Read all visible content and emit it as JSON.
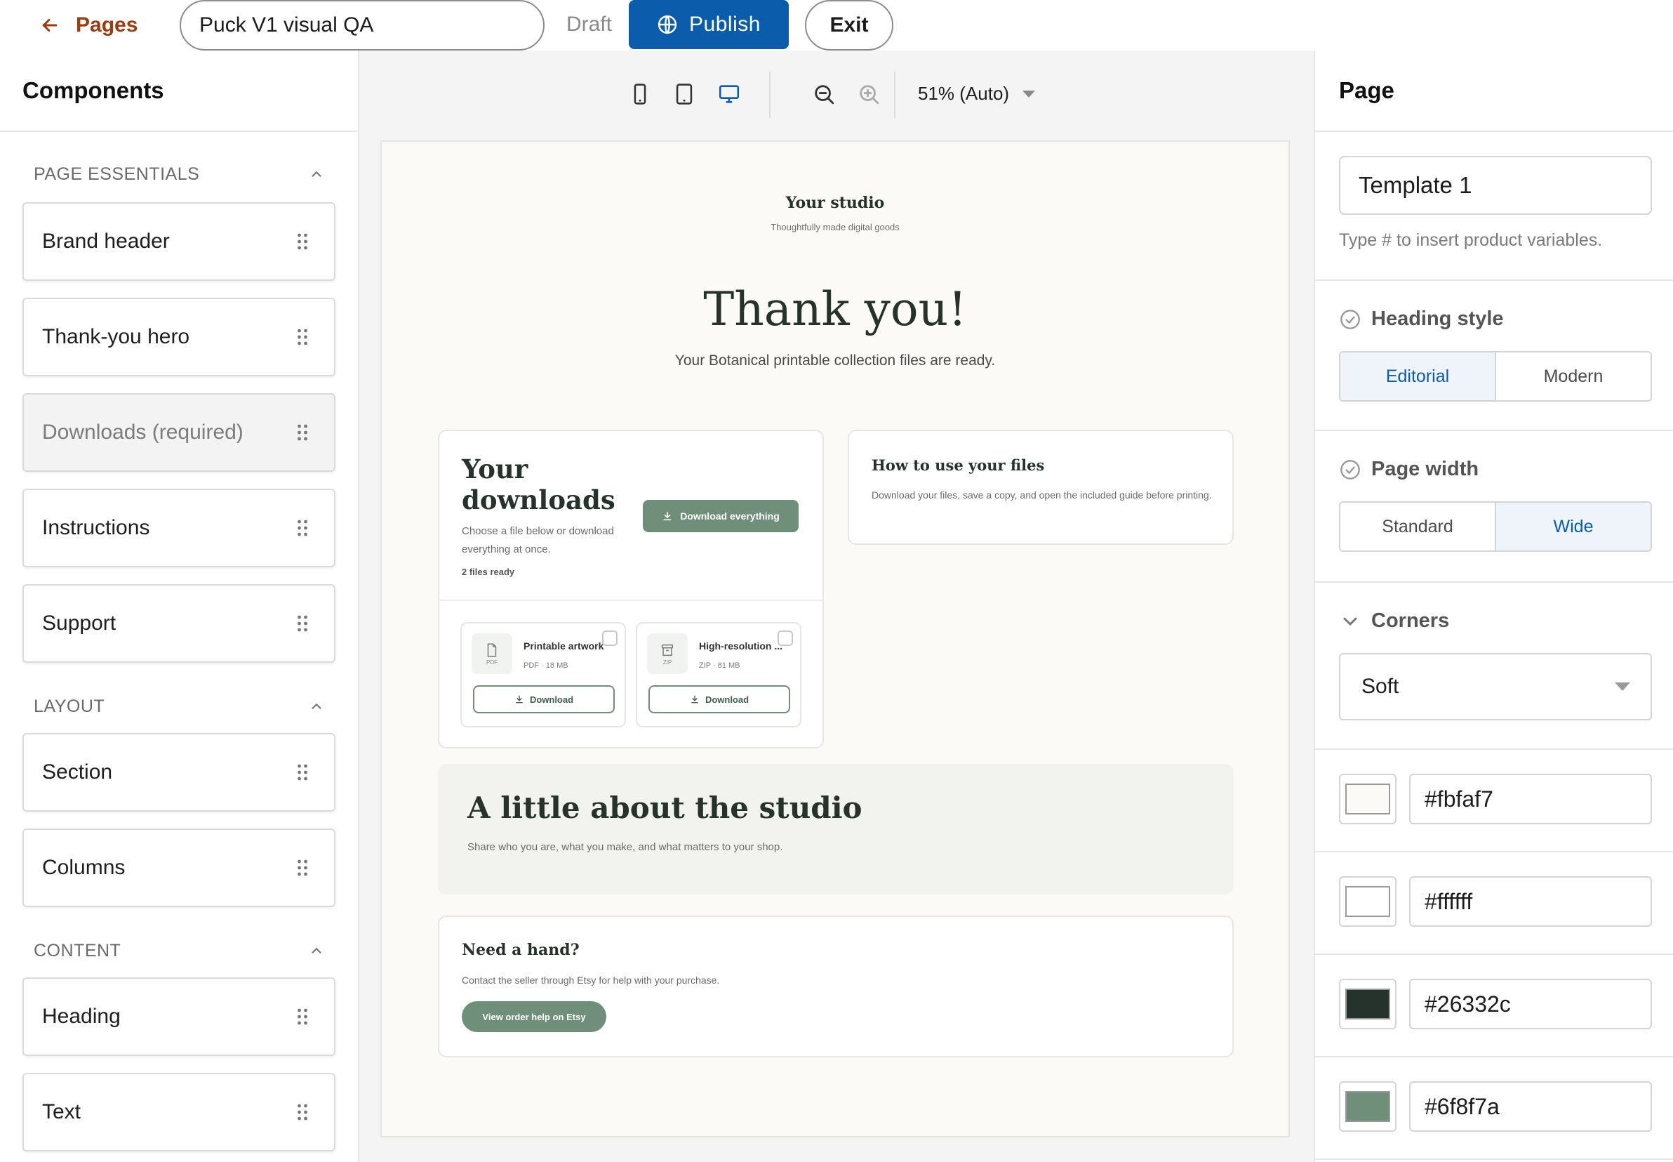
{
  "topbar": {
    "back_label": "Pages",
    "page_title": "Puck V1 visual QA",
    "status": "Draft",
    "publish_label": "Publish",
    "exit_label": "Exit"
  },
  "left_panel": {
    "title": "Components",
    "groups": [
      {
        "label": "PAGE ESSENTIALS",
        "items": [
          "Brand header",
          "Thank-you hero",
          "Downloads (required)",
          "Instructions",
          "Support"
        ]
      },
      {
        "label": "LAYOUT",
        "items": [
          "Section",
          "Columns"
        ]
      },
      {
        "label": "CONTENT",
        "items": [
          "Heading",
          "Text"
        ]
      }
    ]
  },
  "viewport": {
    "zoom_label": "51% (Auto)",
    "active_device": "desktop"
  },
  "preview": {
    "brand_name": "Your studio",
    "brand_tagline": "Thoughtfully made digital goods",
    "hero_title": "Thank you!",
    "hero_subtitle": "Your Botanical printable collection files are ready.",
    "downloads": {
      "title": "Your downloads",
      "description": "Choose a file below or download everything at once.",
      "count_label": "2 files ready",
      "download_all_label": "Download everything",
      "files": [
        {
          "name": "Printable artwork",
          "meta": "PDF · 18 MB",
          "ext": "PDF",
          "button": "Download"
        },
        {
          "name": "High-resolution ...",
          "meta": "ZIP · 81 MB",
          "ext": "ZIP",
          "button": "Download"
        }
      ]
    },
    "instructions": {
      "title": "How to use your files",
      "body": "Download your files, save a copy, and open the included guide before printing."
    },
    "about": {
      "title": "A little about the studio",
      "body": "Share who you are, what you make, and what matters to your shop."
    },
    "support": {
      "title": "Need a hand?",
      "body": "Contact the seller through Etsy for help with your purchase.",
      "button": "View order help on Etsy"
    }
  },
  "right_panel": {
    "title": "Page",
    "template_name": "Template 1",
    "template_hint": "Type # to insert product variables.",
    "heading_style": {
      "label": "Heading style",
      "options": [
        "Editorial",
        "Modern"
      ],
      "selected": "Editorial"
    },
    "page_width": {
      "label": "Page width",
      "options": [
        "Standard",
        "Wide"
      ],
      "selected": "Wide"
    },
    "corners": {
      "label": "Corners",
      "value": "Soft"
    },
    "colors": [
      "#fbfaf7",
      "#ffffff",
      "#26332c",
      "#6f8f7a"
    ]
  }
}
